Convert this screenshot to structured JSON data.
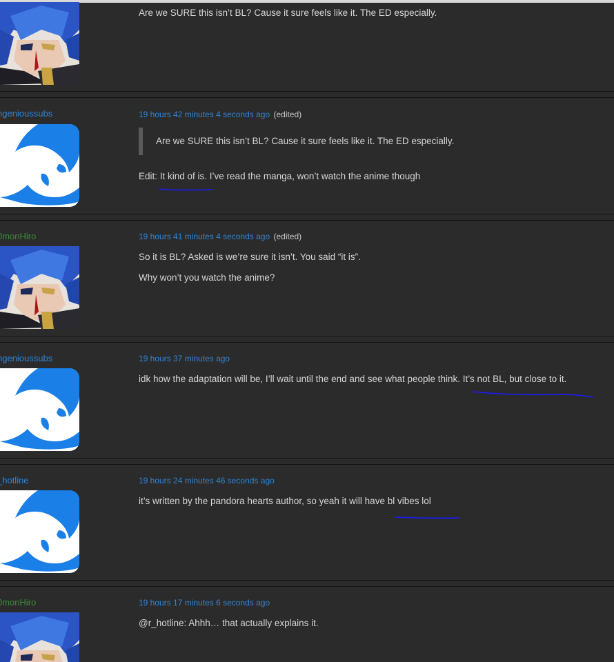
{
  "comments": [
    {
      "username": "",
      "avatar": "anime-portrait",
      "time": "",
      "edited": "",
      "lines": [
        "Are we SURE this isn’t BL? Cause it sure feels like it. The ED especially."
      ]
    },
    {
      "username": "ngenioussubs",
      "avatar": "shared-logo",
      "time": "19 hours 42 minutes 4 seconds ago",
      "edited": "(edited)",
      "quote": "Are we SURE this isn’t BL? Cause it sure feels like it. The ED especially.",
      "lines": [
        "Edit: It kind of is. I’ve read the manga, won’t watch the anime though"
      ]
    },
    {
      "username": "0monHiro",
      "avatar": "anime-portrait",
      "time": "19 hours 41 minutes 4 seconds ago",
      "edited": "(edited)",
      "lines": [
        "So it is BL? Asked is we’re sure it isn’t. You said “it is”.",
        "Why won’t you watch the anime?"
      ]
    },
    {
      "username": "ngenioussubs",
      "avatar": "shared-logo",
      "time": "19 hours 37 minutes ago",
      "edited": "",
      "lines": [
        "idk how the adaptation will be, I’ll wait until the end and see what people think. It’s not BL, but close to it."
      ]
    },
    {
      "username": "_hotline",
      "avatar": "shared-logo",
      "time": "19 hours 24 minutes 46 seconds ago",
      "edited": "",
      "lines": [
        "it’s written by the pandora hearts author, so yeah it will have bl vibes lol"
      ]
    },
    {
      "username": "0monHiro",
      "avatar": "anime-portrait",
      "time": "19 hours 17 minutes 6 seconds ago",
      "edited": "",
      "lines": [
        "@r_hotline: Ahhh… that actually explains it."
      ]
    }
  ],
  "colors": {
    "background": "#2b2b2b",
    "link": "#2f86d8",
    "username_green": "#3f8a3f",
    "scribble": "#1a1aff"
  }
}
